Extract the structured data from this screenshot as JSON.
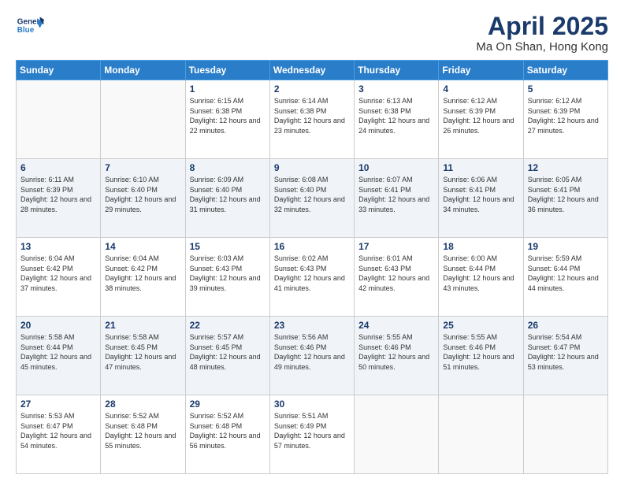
{
  "header": {
    "logo_line1": "General",
    "logo_line2": "Blue",
    "month": "April 2025",
    "location": "Ma On Shan, Hong Kong"
  },
  "days_of_week": [
    "Sunday",
    "Monday",
    "Tuesday",
    "Wednesday",
    "Thursday",
    "Friday",
    "Saturday"
  ],
  "weeks": [
    [
      {
        "day": "",
        "info": ""
      },
      {
        "day": "",
        "info": ""
      },
      {
        "day": "1",
        "info": "Sunrise: 6:15 AM\nSunset: 6:38 PM\nDaylight: 12 hours and 22 minutes."
      },
      {
        "day": "2",
        "info": "Sunrise: 6:14 AM\nSunset: 6:38 PM\nDaylight: 12 hours and 23 minutes."
      },
      {
        "day": "3",
        "info": "Sunrise: 6:13 AM\nSunset: 6:38 PM\nDaylight: 12 hours and 24 minutes."
      },
      {
        "day": "4",
        "info": "Sunrise: 6:12 AM\nSunset: 6:39 PM\nDaylight: 12 hours and 26 minutes."
      },
      {
        "day": "5",
        "info": "Sunrise: 6:12 AM\nSunset: 6:39 PM\nDaylight: 12 hours and 27 minutes."
      }
    ],
    [
      {
        "day": "6",
        "info": "Sunrise: 6:11 AM\nSunset: 6:39 PM\nDaylight: 12 hours and 28 minutes."
      },
      {
        "day": "7",
        "info": "Sunrise: 6:10 AM\nSunset: 6:40 PM\nDaylight: 12 hours and 29 minutes."
      },
      {
        "day": "8",
        "info": "Sunrise: 6:09 AM\nSunset: 6:40 PM\nDaylight: 12 hours and 31 minutes."
      },
      {
        "day": "9",
        "info": "Sunrise: 6:08 AM\nSunset: 6:40 PM\nDaylight: 12 hours and 32 minutes."
      },
      {
        "day": "10",
        "info": "Sunrise: 6:07 AM\nSunset: 6:41 PM\nDaylight: 12 hours and 33 minutes."
      },
      {
        "day": "11",
        "info": "Sunrise: 6:06 AM\nSunset: 6:41 PM\nDaylight: 12 hours and 34 minutes."
      },
      {
        "day": "12",
        "info": "Sunrise: 6:05 AM\nSunset: 6:41 PM\nDaylight: 12 hours and 36 minutes."
      }
    ],
    [
      {
        "day": "13",
        "info": "Sunrise: 6:04 AM\nSunset: 6:42 PM\nDaylight: 12 hours and 37 minutes."
      },
      {
        "day": "14",
        "info": "Sunrise: 6:04 AM\nSunset: 6:42 PM\nDaylight: 12 hours and 38 minutes."
      },
      {
        "day": "15",
        "info": "Sunrise: 6:03 AM\nSunset: 6:43 PM\nDaylight: 12 hours and 39 minutes."
      },
      {
        "day": "16",
        "info": "Sunrise: 6:02 AM\nSunset: 6:43 PM\nDaylight: 12 hours and 41 minutes."
      },
      {
        "day": "17",
        "info": "Sunrise: 6:01 AM\nSunset: 6:43 PM\nDaylight: 12 hours and 42 minutes."
      },
      {
        "day": "18",
        "info": "Sunrise: 6:00 AM\nSunset: 6:44 PM\nDaylight: 12 hours and 43 minutes."
      },
      {
        "day": "19",
        "info": "Sunrise: 5:59 AM\nSunset: 6:44 PM\nDaylight: 12 hours and 44 minutes."
      }
    ],
    [
      {
        "day": "20",
        "info": "Sunrise: 5:58 AM\nSunset: 6:44 PM\nDaylight: 12 hours and 45 minutes."
      },
      {
        "day": "21",
        "info": "Sunrise: 5:58 AM\nSunset: 6:45 PM\nDaylight: 12 hours and 47 minutes."
      },
      {
        "day": "22",
        "info": "Sunrise: 5:57 AM\nSunset: 6:45 PM\nDaylight: 12 hours and 48 minutes."
      },
      {
        "day": "23",
        "info": "Sunrise: 5:56 AM\nSunset: 6:46 PM\nDaylight: 12 hours and 49 minutes."
      },
      {
        "day": "24",
        "info": "Sunrise: 5:55 AM\nSunset: 6:46 PM\nDaylight: 12 hours and 50 minutes."
      },
      {
        "day": "25",
        "info": "Sunrise: 5:55 AM\nSunset: 6:46 PM\nDaylight: 12 hours and 51 minutes."
      },
      {
        "day": "26",
        "info": "Sunrise: 5:54 AM\nSunset: 6:47 PM\nDaylight: 12 hours and 53 minutes."
      }
    ],
    [
      {
        "day": "27",
        "info": "Sunrise: 5:53 AM\nSunset: 6:47 PM\nDaylight: 12 hours and 54 minutes."
      },
      {
        "day": "28",
        "info": "Sunrise: 5:52 AM\nSunset: 6:48 PM\nDaylight: 12 hours and 55 minutes."
      },
      {
        "day": "29",
        "info": "Sunrise: 5:52 AM\nSunset: 6:48 PM\nDaylight: 12 hours and 56 minutes."
      },
      {
        "day": "30",
        "info": "Sunrise: 5:51 AM\nSunset: 6:49 PM\nDaylight: 12 hours and 57 minutes."
      },
      {
        "day": "",
        "info": ""
      },
      {
        "day": "",
        "info": ""
      },
      {
        "day": "",
        "info": ""
      }
    ]
  ]
}
